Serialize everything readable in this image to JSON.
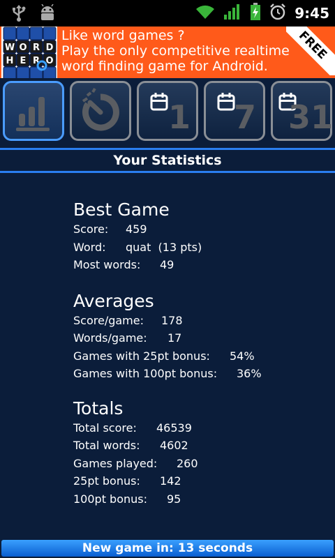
{
  "status_bar": {
    "time": "9:45",
    "icons": [
      "usb-icon",
      "android-debug-icon",
      "wifi-icon",
      "signal-icon",
      "battery-charging-icon",
      "alarm-icon"
    ]
  },
  "ad": {
    "logo_letters": [
      "W",
      "O",
      "R",
      "D",
      "H",
      "E",
      "R",
      "O"
    ],
    "line1": "Like word games ?",
    "line2": "Play the only competitive realtime",
    "line3": "word finding game for Android.",
    "free_label": "FREE"
  },
  "tabs": [
    {
      "name": "statistics",
      "icon": "bar-chart-icon",
      "label": ""
    },
    {
      "name": "timer",
      "icon": "timer-icon",
      "label": ""
    },
    {
      "name": "1-day",
      "icon": "calendar-icon",
      "label": "1"
    },
    {
      "name": "7-days",
      "icon": "calendar-icon",
      "label": "7"
    },
    {
      "name": "31-days",
      "icon": "calendar-icon",
      "label": "31"
    }
  ],
  "page_title": "Your Statistics",
  "best_game": {
    "title": "Best Game",
    "score_label": "Score:",
    "score_value": "459",
    "word_label": "Word:",
    "word_value": "quat  (13 pts)",
    "most_words_label": "Most words:",
    "most_words_value": "49"
  },
  "averages": {
    "title": "Averages",
    "score_label": "Score/game:",
    "score_value": "178",
    "words_label": "Words/game:",
    "words_value": "17",
    "bonus25_label": "Games with 25pt bonus:",
    "bonus25_value": "54%",
    "bonus100_label": "Games with 100pt bonus:",
    "bonus100_value": "36%"
  },
  "totals": {
    "title": "Totals",
    "score_label": "Total score:",
    "score_value": "46539",
    "words_label": "Total words:",
    "words_value": "4602",
    "played_label": "Games played:",
    "played_value": "260",
    "bonus25_label": "25pt bonus:",
    "bonus25_value": "142",
    "bonus100_label": "100pt bonus:",
    "bonus100_value": "95"
  },
  "footer": {
    "text": "New game in: 13 seconds"
  },
  "colors": {
    "background": "#0b1d3a",
    "ad_orange": "#ff5a1a",
    "accent_blue": "#2a7ef0",
    "tab_border": "#8a8f96"
  }
}
